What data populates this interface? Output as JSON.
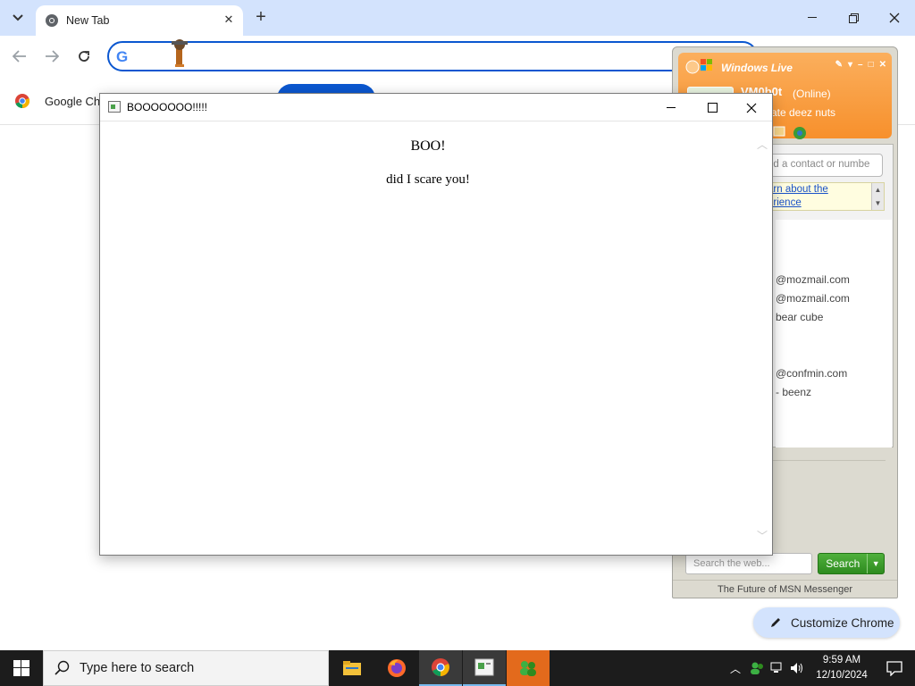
{
  "chrome": {
    "tab_title": "New Tab",
    "tab_close": "✕",
    "new_tab": "+",
    "bookmark_label": "Google Ch",
    "customize_label": "Customize Chrome"
  },
  "msn": {
    "title": "Windows Live",
    "display_name": "VM0b0t",
    "status": "(Online)",
    "personal_message": "rate deez nuts",
    "find_placeholder": "nd a contact or numbe",
    "banner_line1": "arn about the",
    "banner_line2": "erience",
    "contacts": [
      "@mozmail.com",
      "@mozmail.com",
      "bear cube",
      "@confmin.com",
      "- beenz"
    ],
    "search_placeholder": "Search the web...",
    "search_button": "Search",
    "footer": "The Future of MSN Messenger"
  },
  "boo_window": {
    "title": "BOOOOOOO!!!!!",
    "heading": "BOO!",
    "text": "did I scare you!"
  },
  "taskbar": {
    "search_placeholder": "Type here to search",
    "time": "9:59 AM",
    "date": "12/10/2024"
  },
  "colors": {
    "chrome_accent": "#0b57d0",
    "chrome_tabstrip": "#d3e3fd",
    "msn_orange": "#f7902c",
    "msn_search_green": "#2e8b1f",
    "taskbar_bg": "#1c1c1c"
  }
}
